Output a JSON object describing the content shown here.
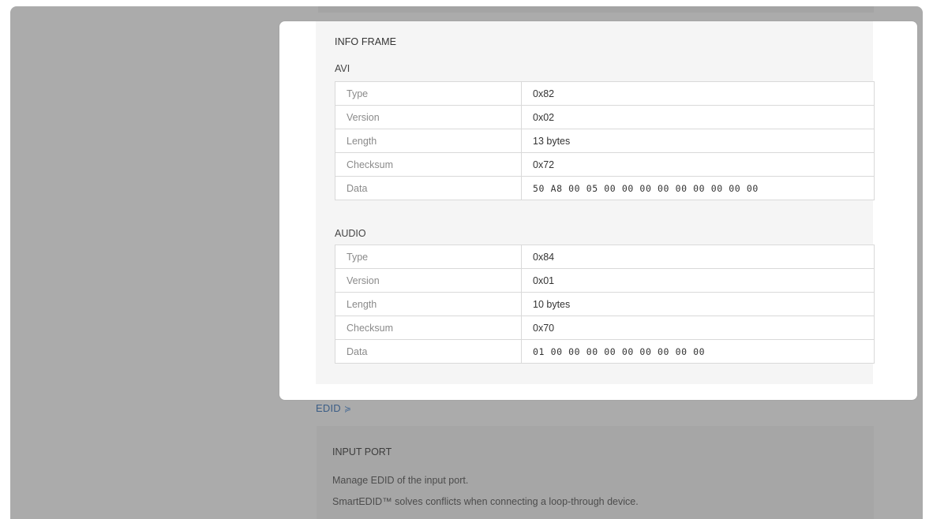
{
  "info_frame": {
    "title": "INFO FRAME",
    "avi": {
      "title": "AVI",
      "rows": [
        {
          "key": "Type",
          "value": "0x82"
        },
        {
          "key": "Version",
          "value": "0x02"
        },
        {
          "key": "Length",
          "value": "13 bytes"
        },
        {
          "key": "Checksum",
          "value": "0x72"
        },
        {
          "key": "Data",
          "value": "50 A8 00 05 00 00 00 00 00 00 00 00 00"
        }
      ]
    },
    "audio": {
      "title": "AUDIO",
      "rows": [
        {
          "key": "Type",
          "value": "0x84"
        },
        {
          "key": "Version",
          "value": "0x01"
        },
        {
          "key": "Length",
          "value": "10 bytes"
        },
        {
          "key": "Checksum",
          "value": "0x70"
        },
        {
          "key": "Data",
          "value": "01 00 00 00 00 00 00 00 00 00"
        }
      ]
    }
  },
  "edid": {
    "link_label": "EDID",
    "chevron": "≽"
  },
  "input_port": {
    "title": "INPUT PORT",
    "desc1": "Manage EDID of the input port.",
    "desc2": "SmartEDID™ solves conflicts when connecting a loop-through device."
  },
  "colors": {
    "overlay": "#ababab",
    "card": "#ffffff",
    "card_inner": "#f5f5f5",
    "link": "#3b5d86"
  }
}
